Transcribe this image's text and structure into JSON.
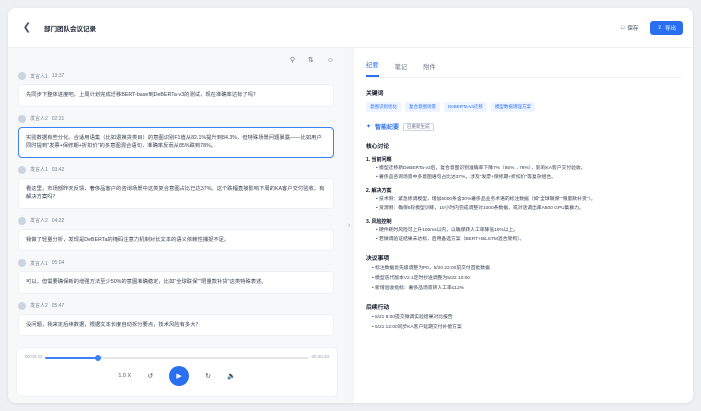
{
  "header": {
    "back_icon": "chevron-left-icon",
    "title": "部门团队会议记录",
    "save_label": "保存",
    "export_label": "导出"
  },
  "left_toolbar": {
    "icons": [
      "search-icon",
      "translate-icon",
      "speaker-icon"
    ]
  },
  "messages": [
    {
      "speaker": "发言人1",
      "time": "13:37",
      "text": "先同步下整体进度吧。上周计划完成迁移BERT-base到DeBERTa-v3的测试，现在准确率达标了吗？"
    },
    {
      "speaker": "发言人2",
      "time": "02:31",
      "text": "实验数据有些分化。合适用语集（比如退换货类目）的意图识别F1值从82.1%提升到84.3%，但特殊场景问题暴露——比如用户同时提到\"发票+保修期+折扣价\"的多意图混合语句，准确率反而从85%跌到78%。"
    },
    {
      "speaker": "发言人1",
      "time": "03:42",
      "text": "看这里，市场部昨天反馈，奢侈品客户的咨询场景中这类复合意图占比已达37%。这个跌幅直接影响下周的KA客户交付验收，有解决方案吗？"
    },
    {
      "speaker": "发言人2",
      "time": "04:22",
      "text": "我做了轻量分析，发现是DeBERTa的掩码注意力机制对长文本的语义依赖性捕捉不足。"
    },
    {
      "speaker": "发言人1",
      "time": "05:04",
      "text": "可以。但需要确保新的增强方法至少50%的意图准确稳定，比如\"全球联保\"\"限量款补货\"这类特殊表述。"
    },
    {
      "speaker": "发言人2",
      "time": "05:47",
      "text": "没问题，我来定后续数据，根据文本长度自动拆分要点，技术风险有多大？"
    }
  ],
  "player": {
    "current": "00:02:22",
    "total": "00:46:33",
    "progress": 0.2,
    "speed": "1.0 X",
    "rewind_icon": "rewind-15-icon",
    "play_icon": "play-icon",
    "forward_icon": "forward-15-icon",
    "volume_icon": "volume-icon"
  },
  "divider_icon": "chevron-right-icon",
  "tabs": [
    "纪要",
    "笔记",
    "附件"
  ],
  "active_tab": "纪要",
  "keywords_title": "关键词",
  "keywords": [
    "意图识别优化",
    "复合意图场景",
    "DeBERTa-v3迁移",
    "模型数据增强方案"
  ],
  "minutes": {
    "title": "智能纪要",
    "badge": "已重新生成",
    "icon": "sparkle-icon"
  },
  "core_title": "核心讨论",
  "core": [
    {
      "heading": "1. 当前问题",
      "items": [
        "模型迁移新DeBERTa-v3后，复合意图识别准确率下降7%（85%→78%），影响KA客户交付验收。",
        "奢侈品咨询场景中多意图语句占比达37%，涉及\"发票+保修期+折扣价\"等复杂组合。"
      ]
    },
    {
      "heading": "2. 解决方案",
      "items": [
        "技术侧：紧急修调模型，增加5000条含30%奢侈品业务术语的标注数据（如\"全球联保\"\"限量款补货\"）。",
        "资源侧：确保5轮模型训练，10小时内完成调整对1000条数据，或对话调出库A800 GPU集群力。"
      ]
    },
    {
      "heading": "3. 风险控制",
      "items": [
        "硬件耗时风险可上升100ms以内，以确保转人工率降低15%以上。",
        "若微调验证结果未达标，启用备选方案（BERT+BiLSTM混合架构）。"
      ]
    }
  ],
  "decision_title": "决议事项",
  "decisions": [
    "标注数据优先级调整为P0，5/20 22:00前交付首批数据",
    "模型迭代版本V2.1定时抄送调整为5/22 10:00",
    "新增验收指标：奢侈品场景转人工率≤12%"
  ],
  "followup_title": "后续行动",
  "followups": [
    "5/21 9:00提交微调实验结果对比报告",
    "5/21 12:00同步KA客户延期交付补偿方案"
  ]
}
